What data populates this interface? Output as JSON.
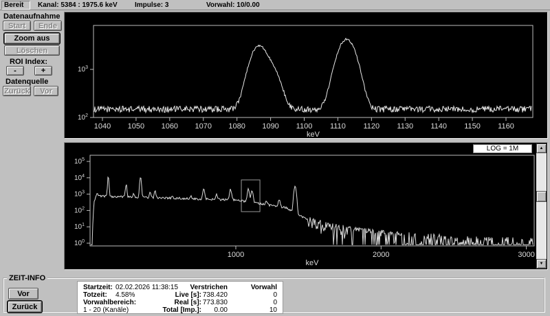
{
  "statusbar": {
    "ready": "Bereit",
    "kanal": "Kanal: 5384  :  1975.6 keV",
    "impulse": "Impulse:  3",
    "vorwahl": "Vorwahl:  10/0.00"
  },
  "sidebar": {
    "datenaufnahme_label": "Datenaufnahme",
    "start": "Start",
    "ende": "Ende",
    "zoom_aus": "Zoom aus",
    "loeschen": "Löschen",
    "roi_index_label": "ROI Index:",
    "roi_minus": "-",
    "roi_plus": "+",
    "datenquelle_label": "Datenquelle",
    "zurueck": "Zurück",
    "vor": "Vor"
  },
  "icons": {
    "up_arrow": "▲",
    "down_arrow": "▼"
  },
  "zeit_info": {
    "title": "ZEIT-INFO",
    "vor_button": "Vor",
    "zurueck_button": "Zurück",
    "table": {
      "startzeit_label": "Startzeit:",
      "startzeit_value": "02.02.2026  11:38:15",
      "verstrichen_header": "Verstrichen",
      "vorwahl_header": "Vorwahl",
      "totzeit_label": "Totzeit:",
      "totzeit_value": "4.58%",
      "live_label": "Live [s]:",
      "live_verstrichen": "738.420",
      "live_vorwahl": "0",
      "vorwahlbereich_label": "Vorwahlbereich:",
      "real_label": "Real [s]:",
      "real_verstrichen": "773.830",
      "real_vorwahl": "0",
      "kanaele_label": "1 - 20 (Kanäle)",
      "total_label": "Total [Imp.]:",
      "total_verstrichen": "0.00",
      "total_vorwahl": "10"
    }
  },
  "colors": {
    "window_bg": "#c0c0c0",
    "plot_bg": "#000000",
    "trace": "#e6e6e6",
    "axis": "#bdbdbd",
    "tick_text": "#dcdcdc",
    "roi_box": "#9a9a9a"
  },
  "chart_data": [
    {
      "id": "zoom_spectrum",
      "type": "line",
      "title": "ROI zoom of gamma spectrum (log counts vs energy)",
      "xlabel": "keV",
      "x_ticks": [
        1040,
        1050,
        1060,
        1070,
        1080,
        1090,
        1100,
        1110,
        1120,
        1130,
        1140,
        1150,
        1160
      ],
      "x_range_keV": [
        1037.3,
        1168.0
      ],
      "y_scale": "log",
      "y_tick_exponents": [
        3,
        2
      ],
      "y_log_range": [
        2,
        3.95
      ],
      "baseline_counts": 150,
      "noise_fraction": 0.3,
      "peaks": [
        {
          "center_keV": 1086.5,
          "amplitude_counts": 2900,
          "sigma_keV": 2.2
        },
        {
          "center_keV": 1090.8,
          "amplitude_counts": 650,
          "sigma_keV": 2.0
        },
        {
          "center_keV": 1112.6,
          "amplitude_counts": 4100,
          "sigma_keV": 2.3
        }
      ]
    },
    {
      "id": "full_spectrum",
      "type": "line",
      "title": "Full gamma spectrum (log counts vs energy)",
      "xlabel": "keV",
      "x_ticks": [
        1000,
        2000,
        3000
      ],
      "x_range_keV": [
        0,
        3055
      ],
      "y_scale": "log",
      "y_tick_exponents": [
        5,
        4,
        3,
        2,
        1,
        0
      ],
      "scale_label": "LOG = 1M",
      "continuum_points": [
        [
          12,
          1
        ],
        [
          18,
          60
        ],
        [
          25,
          400
        ],
        [
          40,
          780
        ],
        [
          122,
          740
        ],
        [
          250,
          680
        ],
        [
          400,
          620
        ],
        [
          600,
          560
        ],
        [
          800,
          500
        ],
        [
          1000,
          430
        ],
        [
          1100,
          340
        ],
        [
          1250,
          200
        ],
        [
          1350,
          150
        ],
        [
          1430,
          55
        ],
        [
          1520,
          22
        ],
        [
          1650,
          10
        ],
        [
          1850,
          5
        ],
        [
          2100,
          3
        ],
        [
          2400,
          2
        ],
        [
          2700,
          1.5
        ],
        [
          3055,
          1.2
        ]
      ],
      "peaks": [
        {
          "center_keV": 45,
          "amplitude_counts": 400,
          "sigma_keV": 3.5
        },
        {
          "center_keV": 122,
          "amplitude_counts": 13000,
          "sigma_keV": 3.5
        },
        {
          "center_keV": 245,
          "amplitude_counts": 3200,
          "sigma_keV": 4
        },
        {
          "center_keV": 296,
          "amplitude_counts": 420,
          "sigma_keV": 4
        },
        {
          "center_keV": 344,
          "amplitude_counts": 10500,
          "sigma_keV": 4.5
        },
        {
          "center_keV": 411,
          "amplitude_counts": 800,
          "sigma_keV": 4.5
        },
        {
          "center_keV": 444,
          "amplitude_counts": 1000,
          "sigma_keV": 4.5
        },
        {
          "center_keV": 564,
          "amplitude_counts": 180,
          "sigma_keV": 5
        },
        {
          "center_keV": 689,
          "amplitude_counts": 220,
          "sigma_keV": 5
        },
        {
          "center_keV": 779,
          "amplitude_counts": 1700,
          "sigma_keV": 5.5
        },
        {
          "center_keV": 867,
          "amplitude_counts": 450,
          "sigma_keV": 5.5
        },
        {
          "center_keV": 964,
          "amplitude_counts": 1500,
          "sigma_keV": 6
        },
        {
          "center_keV": 1086,
          "amplitude_counts": 1600,
          "sigma_keV": 6
        },
        {
          "center_keV": 1112,
          "amplitude_counts": 1400,
          "sigma_keV": 6
        },
        {
          "center_keV": 1213,
          "amplitude_counts": 140,
          "sigma_keV": 6
        },
        {
          "center_keV": 1299,
          "amplitude_counts": 240,
          "sigma_keV": 6
        },
        {
          "center_keV": 1408,
          "amplitude_counts": 3100,
          "sigma_keV": 6.5
        }
      ],
      "roi_box": {
        "x_keV": [
          1038,
          1166
        ],
        "counts_range": [
          85,
          7400
        ]
      }
    }
  ]
}
